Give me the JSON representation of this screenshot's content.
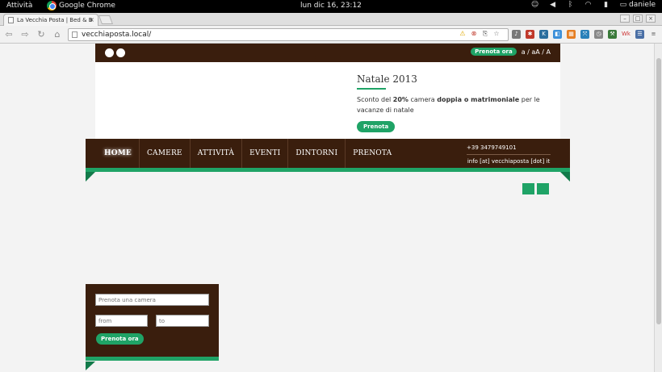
{
  "system_bar": {
    "activities": "Attività",
    "app_name": "Google Chrome",
    "clock": "lun dic 16, 23:12",
    "user": "daniele"
  },
  "browser": {
    "tab_title": "La Vecchia Posta | Bed & B",
    "url": "vecchiaposta.local/"
  },
  "site": {
    "topbar": {
      "book_now": "Prenota ora",
      "font_size_controls": "a / aA / A"
    },
    "promo": {
      "title": "Natale 2013",
      "text_1": "Sconto del ",
      "text_bold_1": "20%",
      "text_2": " camera ",
      "text_bold_2": "doppia o matrimoniale",
      "text_3": " per le vacanze di natale",
      "button": "Prenota"
    },
    "menu": [
      {
        "label": "HOME"
      },
      {
        "label": "CAMERE"
      },
      {
        "label": "ATTIVITÀ"
      },
      {
        "label": "EVENTI"
      },
      {
        "label": "DINTORNI"
      },
      {
        "label": "PRENOTA"
      }
    ],
    "contacts": {
      "phone": "+39 3479749101",
      "email": "info [at] vecchiaposta [dot] it"
    },
    "booking": {
      "room_placeholder": "Prenota una camera",
      "from_placeholder": "from",
      "to_placeholder": "to",
      "button": "Prenota ora"
    }
  },
  "colors": {
    "brown": "#3a1e0d",
    "green": "#1fa366"
  }
}
